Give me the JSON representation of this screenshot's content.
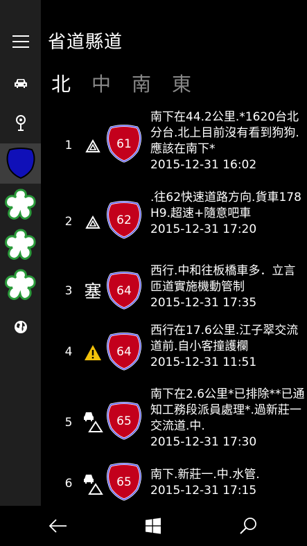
{
  "app": {
    "title": "省道縣道"
  },
  "tabs": [
    {
      "label": "北",
      "active": true
    },
    {
      "label": "中",
      "active": false
    },
    {
      "label": "南",
      "active": false
    },
    {
      "label": "東",
      "active": false
    }
  ],
  "rail": {
    "items": [
      {
        "name": "menu-icon"
      },
      {
        "name": "car-icon"
      },
      {
        "name": "location-pin-icon"
      },
      {
        "name": "provincial-shield-icon",
        "selected": true
      },
      {
        "name": "county-plum-shield-icon"
      },
      {
        "name": "county-plum-shield-icon"
      },
      {
        "name": "county-plum-shield-icon"
      },
      {
        "name": "globe-icon"
      }
    ]
  },
  "incidents": [
    {
      "index": "1",
      "kind_icon": "hazard-triangle-icon",
      "road": "61",
      "description": "南下在44.2公里.*1620台北分台.北上目前沒有看到狗狗.應該在南下*",
      "time": "2015-12-31 16:02"
    },
    {
      "index": "2",
      "kind_icon": "hazard-triangle-icon",
      "road": "62",
      "description": ".往62快速道路方向.貨車178H9.超速+隨意吧車",
      "time": "2015-12-31 17:20"
    },
    {
      "index": "3",
      "kind_text": "塞",
      "kind_icon": "congestion-text-icon",
      "road": "64",
      "description": "西行.中和往板橋車多．立言匝道實施機動管制",
      "time": "2015-12-31 17:35"
    },
    {
      "index": "4",
      "kind_icon": "warning-icon",
      "road": "64",
      "description": "西行在17.6公里.江子翠交流道前.自小客撞護欄",
      "time": "2015-12-31 11:51"
    },
    {
      "index": "5",
      "kind_icon": "car-accident-icon",
      "road": "65",
      "description": "南下在2.6公里*已排除**已通知工務段派員處理*.過新莊一交流道.中.",
      "time": "2015-12-31 17:30"
    },
    {
      "index": "6",
      "kind_icon": "car-accident-icon",
      "road": "65",
      "description": "南下.新莊一.中.水管.",
      "time": "2015-12-31 17:15"
    }
  ],
  "bottom_bar": [
    {
      "name": "back-arrow-icon"
    },
    {
      "name": "windows-start-icon"
    },
    {
      "name": "search-icon"
    }
  ],
  "colors": {
    "shield_red": "#c3001c",
    "shield_border": "#2e2ee6",
    "rail_bg": "#1f1f1f",
    "selected_bg": "#3d3d3d"
  }
}
